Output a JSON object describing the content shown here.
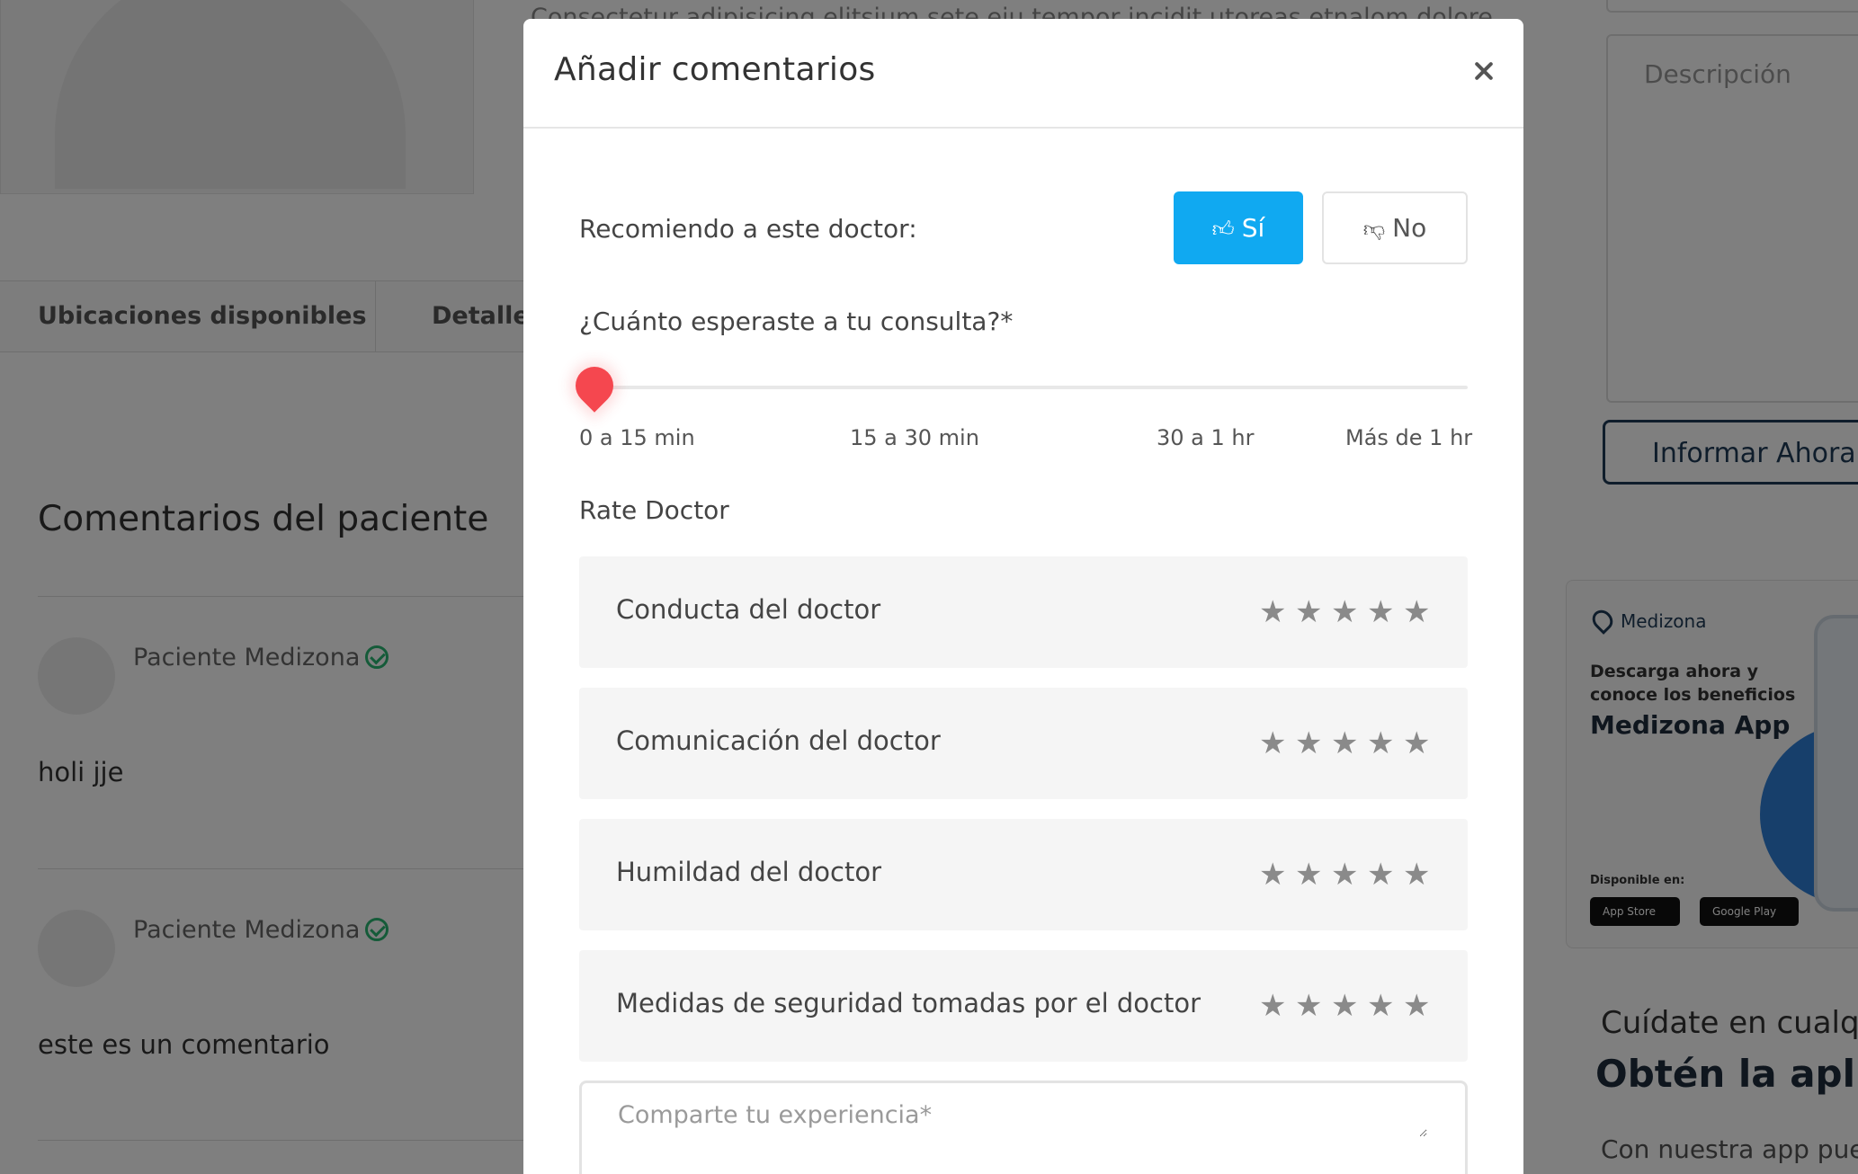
{
  "background": {
    "snippet": "Consectetur adipisicing elitsium sete eiu tempor incidit utoreas etnalom dolore",
    "tabs": [
      "Ubicaciones disponibles",
      "Detalle"
    ],
    "comments_title": "Comentarios del paciente",
    "comments": [
      {
        "user": "Paciente Medizona",
        "text": "holi jje"
      },
      {
        "user": "Paciente Medizona",
        "text": "este es un comentario"
      }
    ],
    "description_placeholder": "Descripción",
    "report_button": "Informar Ahora",
    "ad": {
      "brand": "Medizona",
      "line1": "Descarga ahora y",
      "line2": "conoce los beneficios",
      "app_name": "Medizona App",
      "available": "Disponible en:",
      "store1": "App Store",
      "store2": "Google Play"
    },
    "cta": {
      "line1": "Cuídate en cualq",
      "line2": "Obtén la apli",
      "line3": "Con nuestra app pue"
    }
  },
  "modal": {
    "title": "Añadir comentarios",
    "close_icon": "close-icon",
    "recommend_label": "Recomiendo a este doctor:",
    "yes_label": "Sí",
    "no_label": "No",
    "yes_selected": true,
    "wait_label": "¿Cuánto esperaste a tu consulta?*",
    "wait_options": [
      "0 a 15 min",
      "15 a 30 min",
      "30 a 1 hr",
      "Más de 1 hr"
    ],
    "wait_selected": "0 a 15 min",
    "rate_title": "Rate Doctor",
    "ratings": [
      {
        "label": "Conducta del doctor",
        "stars": 0
      },
      {
        "label": "Comunicación del doctor",
        "stars": 0
      },
      {
        "label": "Humildad del doctor",
        "stars": 0
      },
      {
        "label": "Medidas de seguridad tomadas por el doctor",
        "stars": 0
      }
    ],
    "max_stars": 5,
    "experience_placeholder": "Comparte tu experiencia*",
    "experience_value": ""
  },
  "colors": {
    "primary": "#10a9f1",
    "slider_knob": "#f5474f",
    "verified": "#2bb673",
    "brand_dark": "#1f3a57"
  }
}
